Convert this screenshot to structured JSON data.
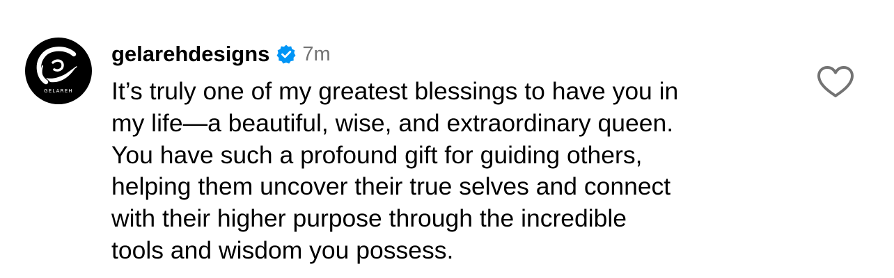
{
  "comment": {
    "author": {
      "username": "gelarehdesigns",
      "verified": true,
      "avatar_wordmark": "GELAREH",
      "avatar_icon": "gelareh-logo"
    },
    "timestamp": "7m",
    "text_lines": [
      "It’s truly one of my greatest blessings to have you in",
      "my life—a beautiful, wise, and extraordinary queen.",
      "You have such a profound gift for guiding others,",
      "helping them uncover their true selves and connect",
      "with their higher purpose through the incredible",
      "tools and wisdom you possess."
    ],
    "like_icon": "heart-outline-icon"
  },
  "colors": {
    "text": "#000000",
    "muted": "#737373",
    "verified_blue": "#0095F6",
    "avatar_bg": "#000000"
  }
}
